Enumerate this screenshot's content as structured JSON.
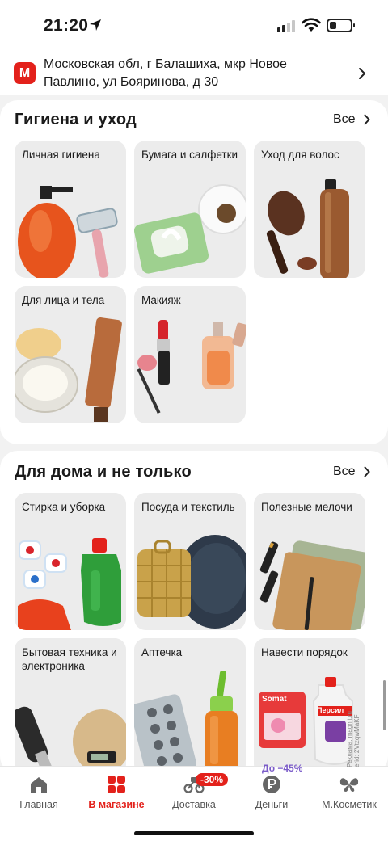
{
  "status_bar": {
    "time": "21:20"
  },
  "address": {
    "logo_letter": "М",
    "text": "Московская обл, г Балашиха, мкр Новое Павлино, ул Бояринова, д 30"
  },
  "sections": [
    {
      "title": "Гигиена и уход",
      "all_label": "Все",
      "tiles": [
        {
          "label": "Личная гигиена"
        },
        {
          "label": "Бумага и салфетки"
        },
        {
          "label": "Уход для волос"
        },
        {
          "label": "Для лица и тела"
        },
        {
          "label": "Макияж"
        }
      ]
    },
    {
      "title": "Для дома и не только",
      "all_label": "Все",
      "tiles": [
        {
          "label": "Стирка и уборка"
        },
        {
          "label": "Посуда и текстиль"
        },
        {
          "label": "Полезные мелочи"
        },
        {
          "label": "Бытовая техника и электроника"
        },
        {
          "label": "Аптечка"
        },
        {
          "label": "Навести порядок",
          "promo": "До −45%",
          "product_text_1": "Somat",
          "product_text_2": "Персил",
          "watermark_1": "erid: 2VtzqwMaKF",
          "watermark_2": "Реклама. magnit.ru"
        }
      ]
    }
  ],
  "tabbar": {
    "tabs": [
      {
        "label": "Главная",
        "icon": "home-icon",
        "active": false
      },
      {
        "label": "В магазине",
        "icon": "store-grid-icon",
        "active": true
      },
      {
        "label": "Доставка",
        "icon": "delivery-scooter-icon",
        "active": false,
        "badge": "-30%"
      },
      {
        "label": "Деньги",
        "icon": "ruble-icon",
        "active": false
      },
      {
        "label": "М.Косметик",
        "icon": "butterfly-icon",
        "active": false
      }
    ]
  },
  "colors": {
    "brand": "#e3211b",
    "promo": "#7b5cc9"
  }
}
